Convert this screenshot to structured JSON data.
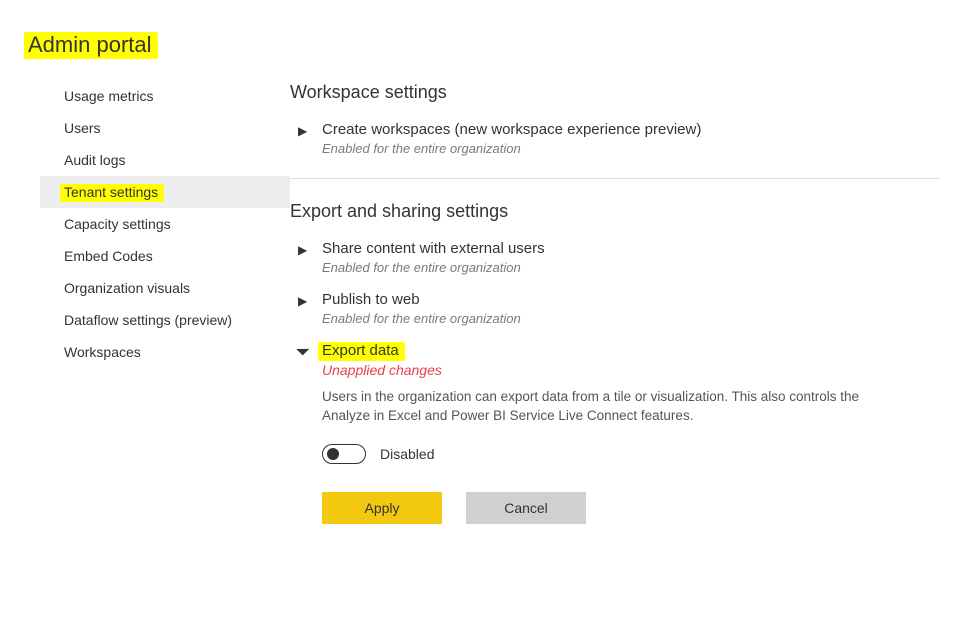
{
  "page_title": "Admin portal",
  "sidebar": {
    "items": [
      {
        "label": "Usage metrics"
      },
      {
        "label": "Users"
      },
      {
        "label": "Audit logs"
      },
      {
        "label": "Tenant settings",
        "active": true,
        "highlighted": true
      },
      {
        "label": "Capacity settings"
      },
      {
        "label": "Embed Codes"
      },
      {
        "label": "Organization visuals"
      },
      {
        "label": "Dataflow settings (preview)"
      },
      {
        "label": "Workspaces"
      }
    ]
  },
  "sections": {
    "workspace": {
      "title": "Workspace settings",
      "items": [
        {
          "label": "Create workspaces (new workspace experience preview)",
          "sub": "Enabled for the entire organization",
          "expanded": false
        }
      ]
    },
    "export": {
      "title": "Export and sharing settings",
      "items": [
        {
          "label": "Share content with external users",
          "sub": "Enabled for the entire organization",
          "expanded": false
        },
        {
          "label": "Publish to web",
          "sub": "Enabled for the entire organization",
          "expanded": false
        },
        {
          "label": "Export data",
          "unapplied": "Unapplied changes",
          "expanded": true,
          "highlighted": true,
          "desc": "Users in the organization can export data from a tile or visualization. This also controls the Analyze in Excel and Power BI Service Live Connect features.",
          "toggle_label": "Disabled",
          "toggle_on": false
        }
      ]
    }
  },
  "buttons": {
    "apply": "Apply",
    "cancel": "Cancel"
  },
  "glyphs": {
    "chevron_right": "▶",
    "chevron_down": "◢"
  }
}
